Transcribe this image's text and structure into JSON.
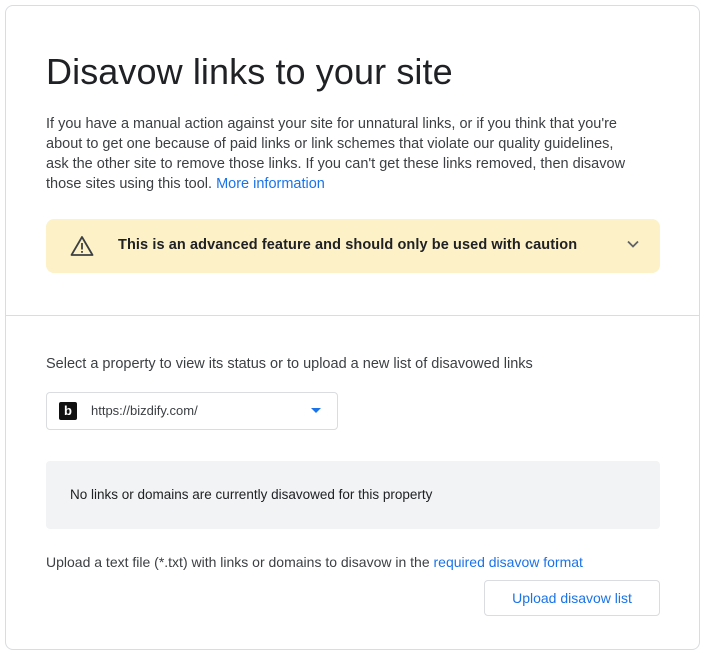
{
  "page": {
    "title": "Disavow links to your site",
    "intro_text": "If you have a manual action against your site for unnatural links, or if you think that you're about to get one because of paid links or link schemes that violate our quality guidelines, ask the other site to remove those links. If you can't get these links removed, then disavow those sites using this tool.",
    "more_info_link": "More information"
  },
  "warning": {
    "text": "This is an advanced feature and should only be used with caution",
    "icon": "warning-icon",
    "expand_icon": "chevron-down-icon",
    "background": "#fdf1c7"
  },
  "property": {
    "label": "Select a property to view its status or to upload a new list of disavowed links",
    "favicon_letter": "b",
    "selected_url": "https://bizdify.com/"
  },
  "status": {
    "message": "No links or domains are currently disavowed for this property"
  },
  "upload": {
    "text": "Upload a text file (*.txt) with links or domains to disavow in the",
    "format_link": "required disavow format",
    "button_label": "Upload disavow list"
  },
  "colors": {
    "accent": "#1a73e8",
    "text": "#202124",
    "secondary_text": "#3c4043",
    "border": "#dadce0",
    "status_bg": "#f1f3f4"
  }
}
